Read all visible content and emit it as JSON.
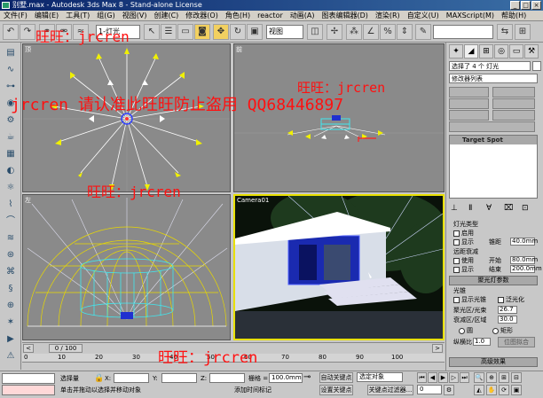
{
  "window": {
    "title": "别墅.max - Autodesk 3ds Max 8 - Stand-alone License",
    "minimize": "_",
    "maximize": "□",
    "close": "×"
  },
  "menu": [
    "文件(F)",
    "编辑(E)",
    "工具(T)",
    "组(G)",
    "视图(V)",
    "创建(C)",
    "修改器(O)",
    "角色(H)",
    "reactor",
    "动画(A)",
    "图表编辑器(D)",
    "渲染(R)",
    "自定义(U)",
    "MAXScript(M)",
    "帮助(H)"
  ],
  "toolbar": {
    "selection_filter": "1-灯光",
    "view_dropdown": "视图",
    "named_selection": ""
  },
  "viewports": {
    "top_left": {
      "label": "顶"
    },
    "top_right": {
      "label": "前"
    },
    "bottom_left": {
      "label": "左"
    },
    "bottom_right": {
      "label": "Camera01"
    }
  },
  "command_panel": {
    "selected_info": "选择了 4 个 灯光",
    "modifier_list": "修改器列表",
    "stack_item": "Target Spot",
    "general_params": {
      "hdr": "常规参数",
      "light_type": "灯光类型",
      "on_label": "启用",
      "show_label": "显示",
      "distance_label": "锥距",
      "distance_value": "40.0mm"
    },
    "attenuation": {
      "hdr": "远距衰减",
      "use_label": "使用",
      "start_label": "开始",
      "start_value": "80.0mm",
      "show_label": "显示",
      "end_label": "结束",
      "end_value": "200.0mm"
    },
    "spotlight_params": {
      "hdr": "聚光灯参数",
      "light_cone": "光锥",
      "show_cone": "显示光锥",
      "overshoot": "泛光化",
      "hotspot_label": "聚光区/光束",
      "hotspot_value": "26.7",
      "falloff_label": "衰减区/区域",
      "falloff_value": "30.0",
      "circle": "圆",
      "rectangle": "矩形",
      "aspect_label": "纵横比",
      "aspect_value": "1.0",
      "bitmap_fit": "位图拟合"
    },
    "rollout_bottom": "高级效果"
  },
  "timeline": {
    "frame_display": "0 / 100",
    "ticks": [
      "0",
      "10",
      "20",
      "30",
      "40",
      "50",
      "60",
      "70",
      "80",
      "90",
      "100"
    ]
  },
  "status": {
    "selected": "选择量",
    "x_label": "X:",
    "y_label": "Y:",
    "z_label": "Z:",
    "grid_label": "栅格 =",
    "grid_value": "100.0mm",
    "auto_key": "自动关键点",
    "auto_key_value": "选定对象",
    "set_key": "设置关键点",
    "key_filters": "关键点过滤器...",
    "prompt": "单击并拖动以选择并移动对象",
    "add_time_tag": "添加时间标记",
    "frame": "0"
  },
  "watermarks": [
    "旺旺：jrcren",
    "旺旺：jrcren",
    "jrcren 请认准此旺旺防止盗用 QQ68446897",
    "旺旺：jrcren",
    "旺旺：jrcren"
  ],
  "colors": {
    "viewport_grey": "#8a8a8a",
    "active_viewport_border": "#e8e000",
    "light_yellow": "#f0f000",
    "light_white": "#ffffff",
    "cyan_wire": "#40e8f0",
    "watermark_red": "#ff1010",
    "title_blue": "#0a246a"
  }
}
